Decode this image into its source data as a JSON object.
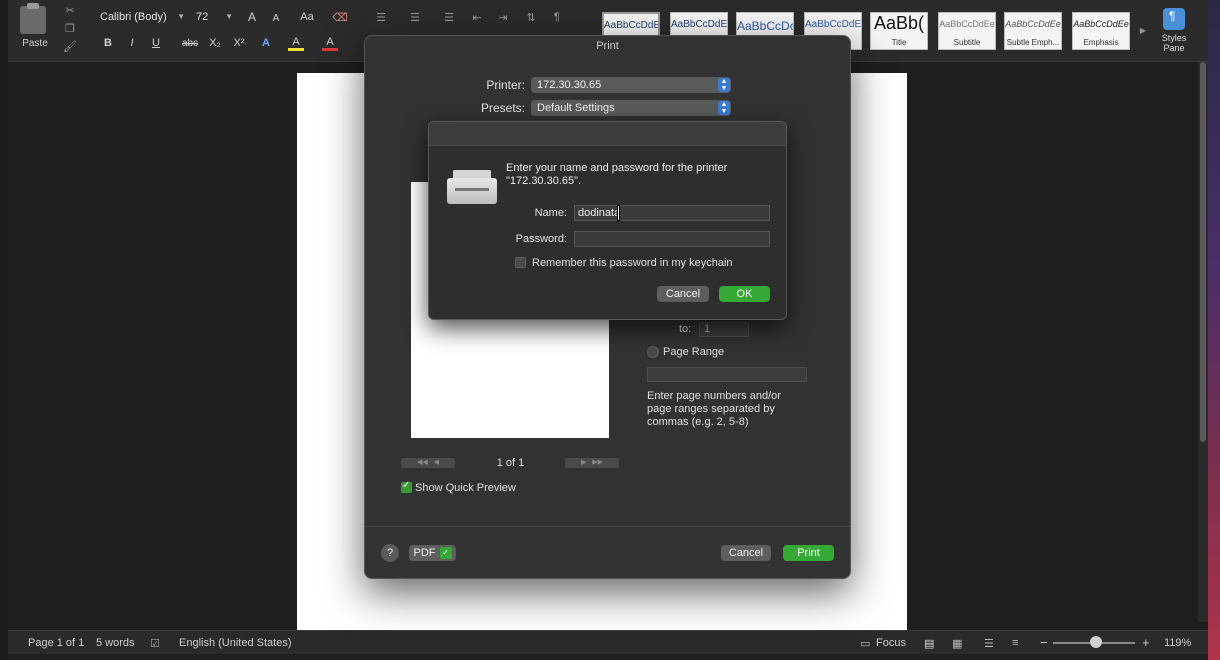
{
  "ribbon": {
    "paste_label": "Paste",
    "font_name": "Calibri (Body)",
    "font_size": "72",
    "grow_font": "A",
    "shrink_font": "A",
    "bold": "B",
    "italic": "I",
    "underline": "U",
    "strikethrough": "abc",
    "subscript": "X₂",
    "superscript": "X²",
    "font_color_letter": "A",
    "highlight_letter": "A",
    "styles": [
      {
        "sample": "AaBbCcDdEe",
        "label": ""
      },
      {
        "sample": "AaBbCcDdEe",
        "label": ""
      },
      {
        "sample": "AaBbCcDc",
        "label": ""
      },
      {
        "sample": "AaBbCcDdEe",
        "label": ""
      },
      {
        "sample": "AaBb(",
        "label": "Title"
      },
      {
        "sample": "AaBbCcDdEe",
        "label": "Subtitle"
      },
      {
        "sample": "AaBbCcDdEe",
        "label": "Subtle Emph..."
      },
      {
        "sample": "AaBbCcDdEe",
        "label": "Emphasis"
      }
    ],
    "styles_pane_label": "Styles Pane"
  },
  "print_dialog": {
    "title": "Print",
    "printer_label": "Printer:",
    "printer_value": "172.30.30.65",
    "presets_label": "Presets:",
    "presets_value": "Default Settings",
    "to_label": "to:",
    "to_value": "1",
    "page_range_label": "Page Range",
    "page_range_help": "Enter page numbers and/or page ranges separated by commas (e.g. 2, 5-8)",
    "page_counter": "1 of 1",
    "show_preview_label": "Show Quick Preview",
    "help_label": "?",
    "pdf_label": "PDF",
    "cancel_label": "Cancel",
    "print_label": "Print"
  },
  "auth_sheet": {
    "message": "Enter your name and password for the printer \"172.30.30.65\".",
    "name_label": "Name:",
    "name_value": "dodinata",
    "password_label": "Password:",
    "password_value": "",
    "remember_label": "Remember this password in my keychain",
    "cancel_label": "Cancel",
    "ok_label": "OK"
  },
  "statusbar": {
    "page_info": "Page 1 of 1",
    "word_count": "5 words",
    "language": "English (United States)",
    "focus_label": "Focus",
    "zoom_minus": "−",
    "zoom_plus": "+",
    "zoom_level": "119%"
  },
  "colors": {
    "accent_green": "#35a835",
    "stepper_blue": "#3a7bd5"
  }
}
